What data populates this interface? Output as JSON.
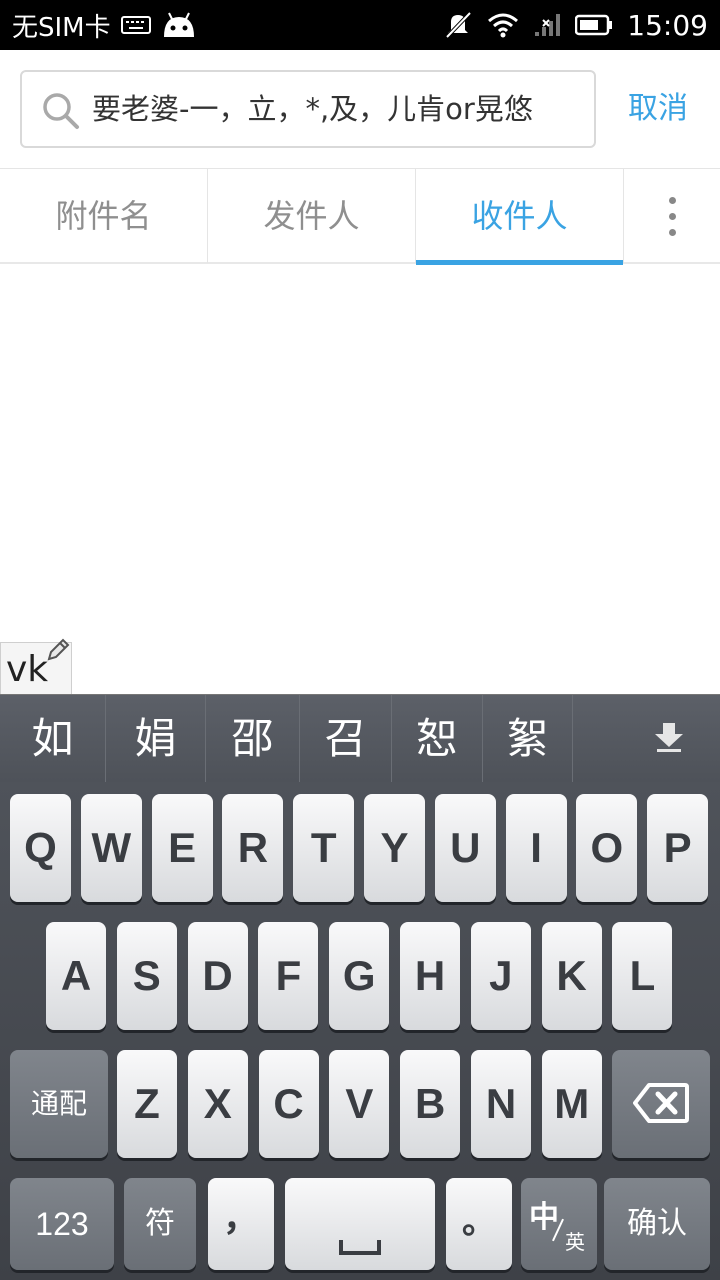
{
  "status_bar": {
    "carrier": "无SIM卡",
    "time": "15:09",
    "icons": [
      "keyboard-icon",
      "android-icon",
      "muted-icon",
      "wifi-icon",
      "signal-icon",
      "battery-icon"
    ]
  },
  "search": {
    "query": "要老婆-一，立，*,及，儿肯or晃悠",
    "cancel_label": "取消"
  },
  "tabs": [
    {
      "label": "附件名",
      "active": false
    },
    {
      "label": "发件人",
      "active": false
    },
    {
      "label": "收件人",
      "active": true
    }
  ],
  "compose": {
    "text": "vk"
  },
  "candidates": [
    "如",
    "娟",
    "邵",
    "召",
    "恕",
    "絮"
  ],
  "keyboard": {
    "row1": [
      "Q",
      "W",
      "E",
      "R",
      "T",
      "Y",
      "U",
      "I",
      "O",
      "P"
    ],
    "row2": [
      "A",
      "S",
      "D",
      "F",
      "G",
      "H",
      "J",
      "K",
      "L"
    ],
    "row3": [
      "Z",
      "X",
      "C",
      "V",
      "B",
      "N",
      "M"
    ],
    "match_label": "通配",
    "numbers_label": "123",
    "symbols_label": "符",
    "comma_label": "，",
    "period_label": "。",
    "lang_main": "中",
    "lang_sub": "英",
    "confirm_label": "确认"
  },
  "colors": {
    "accent": "#3aa3e3",
    "status_bar": "#000000",
    "keyboard_bg": "#45494f",
    "key_light": "#eeeff1",
    "key_dark": "#757a81"
  }
}
